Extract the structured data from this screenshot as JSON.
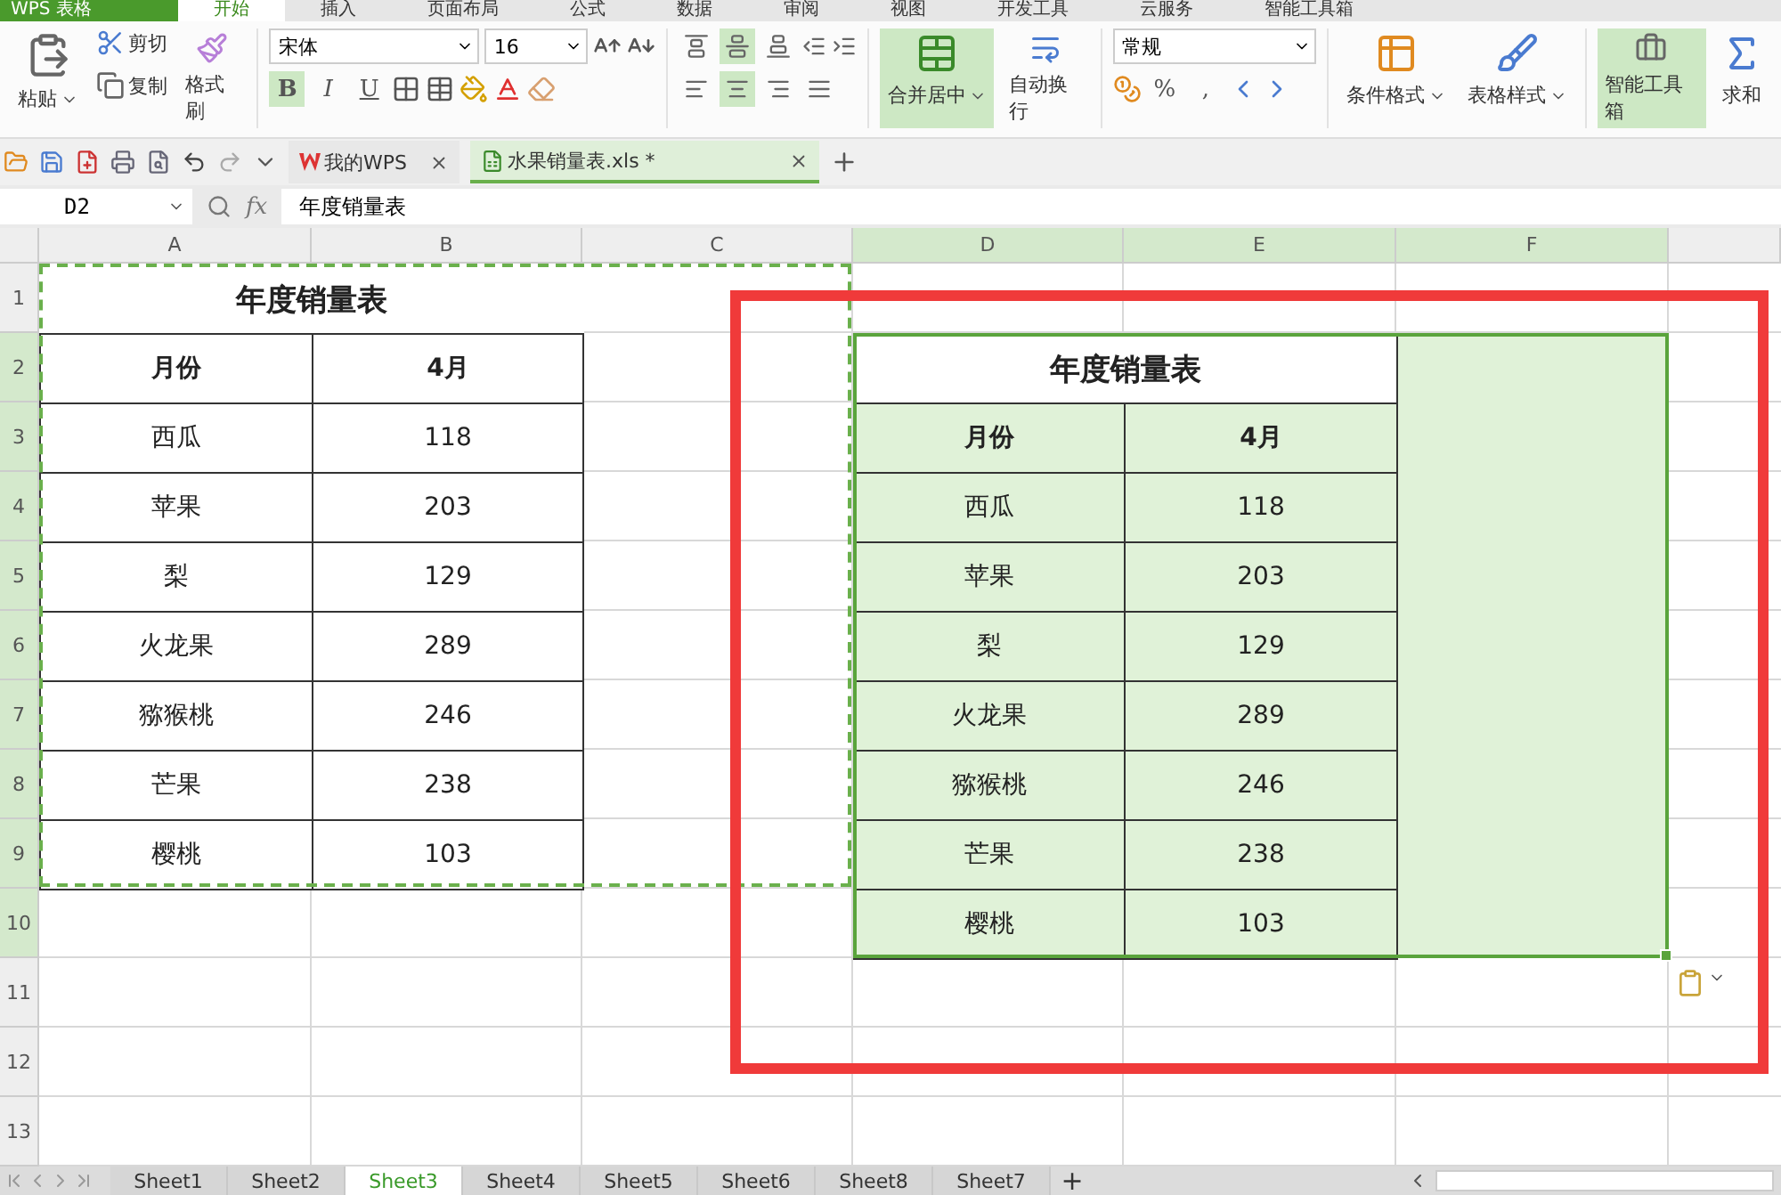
{
  "app_button": "WPS 表格",
  "menu_tabs": [
    {
      "label": "开始",
      "selected": true
    },
    {
      "label": "插入",
      "selected": false
    },
    {
      "label": "页面布局",
      "selected": false
    },
    {
      "label": "公式",
      "selected": false
    },
    {
      "label": "数据",
      "selected": false
    },
    {
      "label": "审阅",
      "selected": false
    },
    {
      "label": "视图",
      "selected": false
    },
    {
      "label": "开发工具",
      "selected": false
    },
    {
      "label": "云服务",
      "selected": false
    },
    {
      "label": "智能工具箱",
      "selected": false
    }
  ],
  "ribbon": {
    "paste": "粘贴",
    "cut": "剪切",
    "copy": "复制",
    "format_painter": "格式刷",
    "font_name": "宋体",
    "font_size": "16",
    "styles": [
      {
        "label": "B",
        "kind": "bold",
        "selected": true
      },
      {
        "label": "I",
        "kind": "italic",
        "selected": false
      },
      {
        "label": "U",
        "kind": "underline",
        "selected": false
      }
    ],
    "vertical_align": [
      {
        "kind": "top",
        "selected": false
      },
      {
        "kind": "middle",
        "selected": true
      },
      {
        "kind": "bottom",
        "selected": false
      }
    ],
    "horizontal_align": [
      {
        "kind": "left",
        "selected": false
      },
      {
        "kind": "center",
        "selected": true
      },
      {
        "kind": "right",
        "selected": false
      },
      {
        "kind": "justify",
        "selected": false
      }
    ],
    "merge": {
      "label": "合并居中",
      "selected": true
    },
    "wrap": "自动换行",
    "number_format": "常规",
    "percent": "%",
    "comma": ",",
    "conditional_format": "条件格式",
    "table_style": "表格样式",
    "smart_toolbox": {
      "label": "智能工具箱",
      "selected": true
    },
    "sum": "求和"
  },
  "doc_tabs": [
    {
      "label": "我的WPS",
      "selected": false
    },
    {
      "label": "水果销量表.xls *",
      "selected": true
    }
  ],
  "formula_bar": {
    "name_box": "D2",
    "fx": "fx",
    "value": "年度销量表"
  },
  "columns": [
    {
      "label": "A",
      "selected": false
    },
    {
      "label": "B",
      "selected": false
    },
    {
      "label": "C",
      "selected": false
    },
    {
      "label": "D",
      "selected": true
    },
    {
      "label": "E",
      "selected": true
    },
    {
      "label": "F",
      "selected": true
    }
  ],
  "rows": [
    {
      "label": "1",
      "selected": false
    },
    {
      "label": "2",
      "selected": true
    },
    {
      "label": "3",
      "selected": true
    },
    {
      "label": "4",
      "selected": true
    },
    {
      "label": "5",
      "selected": true
    },
    {
      "label": "6",
      "selected": true
    },
    {
      "label": "7",
      "selected": true
    },
    {
      "label": "8",
      "selected": true
    },
    {
      "label": "9",
      "selected": true
    },
    {
      "label": "10",
      "selected": true
    },
    {
      "label": "11",
      "selected": false
    },
    {
      "label": "12",
      "selected": false
    },
    {
      "label": "13",
      "selected": false
    }
  ],
  "tables": [
    {
      "title": "年度销量表",
      "header": [
        "月份",
        "4月"
      ],
      "copied": true,
      "selected": false,
      "rows": [
        [
          "西瓜",
          "118"
        ],
        [
          "苹果",
          "203"
        ],
        [
          "梨",
          "129"
        ],
        [
          "火龙果",
          "289"
        ],
        [
          "猕猴桃",
          "246"
        ],
        [
          "芒果",
          "238"
        ],
        [
          "樱桃",
          "103"
        ]
      ]
    },
    {
      "title": "年度销量表",
      "header": [
        "月份",
        "4月"
      ],
      "copied": false,
      "selected": true,
      "rows": [
        [
          "西瓜",
          "118"
        ],
        [
          "苹果",
          "203"
        ],
        [
          "梨",
          "129"
        ],
        [
          "火龙果",
          "289"
        ],
        [
          "猕猴桃",
          "246"
        ],
        [
          "芒果",
          "238"
        ],
        [
          "樱桃",
          "103"
        ]
      ]
    }
  ],
  "sheet_tabs": [
    {
      "label": "Sheet1",
      "selected": false
    },
    {
      "label": "Sheet2",
      "selected": false
    },
    {
      "label": "Sheet3",
      "selected": true
    },
    {
      "label": "Sheet4",
      "selected": false
    },
    {
      "label": "Sheet5",
      "selected": false
    },
    {
      "label": "Sheet6",
      "selected": false
    },
    {
      "label": "Sheet8",
      "selected": false
    },
    {
      "label": "Sheet7",
      "selected": false
    }
  ],
  "add_sheet": "+"
}
